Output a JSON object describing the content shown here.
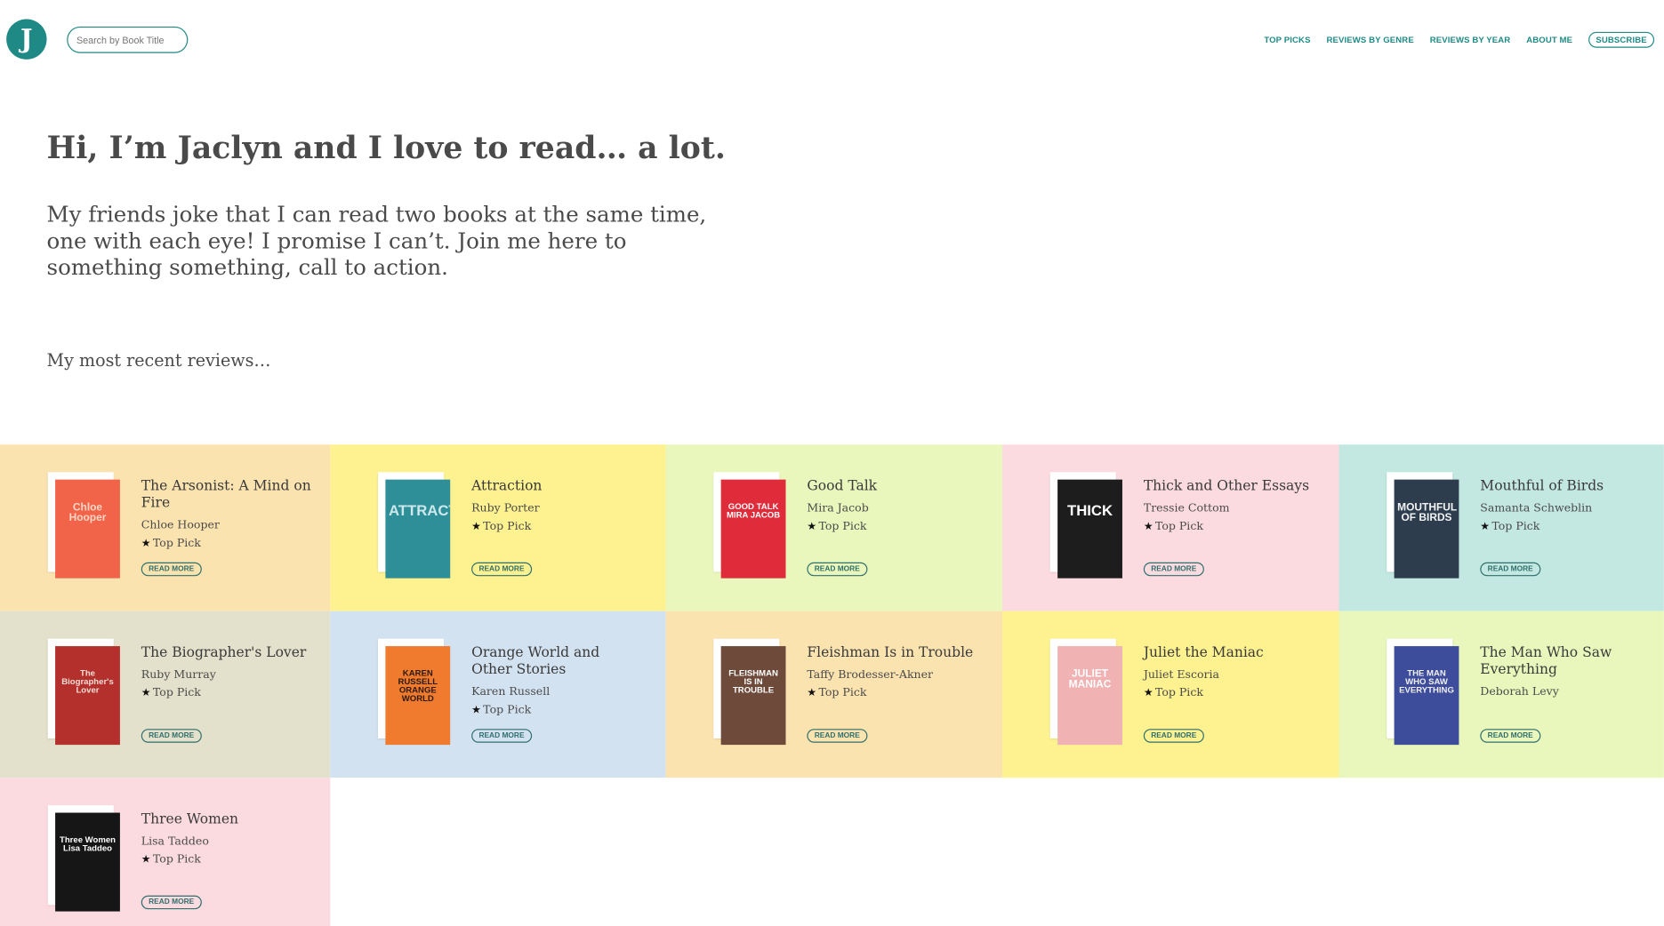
{
  "header": {
    "logo_letter": "J",
    "search_placeholder": "Search by Book Title",
    "nav": [
      {
        "label": "TOP PICKS"
      },
      {
        "label": "REVIEWS BY GENRE"
      },
      {
        "label": "REVIEWS BY YEAR"
      },
      {
        "label": "ABOUT ME"
      },
      {
        "label": "SUBSCRIBE"
      }
    ]
  },
  "hero": {
    "title": "Hi, I’m Jaclyn and I love to read… a lot.",
    "intro": "My friends joke that I can read two books at the same time, one with each eye! I promise I can’t. Join me here to something something, call to action.",
    "recent_label": "My most recent reviews…"
  },
  "read_more_label": "READ MORE",
  "top_pick_label": "Top Pick",
  "books": [
    {
      "title": "The Arsonist: A Mind on Fire",
      "author": "Chloe Hooper",
      "top_pick": true,
      "bg": "#fbe3b0",
      "cover_bg": "#f2644a",
      "cover_text": "Chloe Hooper",
      "cover_fg": "#fbd6c6"
    },
    {
      "title": "Attraction",
      "author": "Ruby Porter",
      "top_pick": true,
      "bg": "#fdf190",
      "cover_bg": "#2f8f98",
      "cover_text": "ATTRACTION",
      "cover_fg": "#cde8ec"
    },
    {
      "title": "Good Talk",
      "author": "Mira Jacob",
      "top_pick": true,
      "bg": "#eaf7bc",
      "cover_bg": "#e02c3a",
      "cover_text": "GOOD TALK MIRA JACOB",
      "cover_fg": "#ffffff"
    },
    {
      "title": "Thick and Other Essays",
      "author": "Tressie Cottom",
      "top_pick": true,
      "bg": "#fbdbe0",
      "cover_bg": "#1d1d1d",
      "cover_text": "THICK",
      "cover_fg": "#ffffff"
    },
    {
      "title": "Mouthful of Birds",
      "author": "Samanta Schweblin",
      "top_pick": true,
      "bg": "#c3e8e2",
      "cover_bg": "#2d3d4e",
      "cover_text": "MOUTHFUL OF BIRDS",
      "cover_fg": "#f3f3f3"
    },
    {
      "title": "The Biographer's Lover",
      "author": "Ruby Murray",
      "top_pick": true,
      "bg": "#e3e1cb",
      "cover_bg": "#b3302c",
      "cover_text": "The Biographer's Lover",
      "cover_fg": "#f6ddd6"
    },
    {
      "title": "Orange World and Other Stories",
      "author": "Karen Russell",
      "top_pick": true,
      "bg": "#d3e2f0",
      "cover_bg": "#f07a2e",
      "cover_text": "KAREN RUSSELL ORANGE WORLD",
      "cover_fg": "#2a1a10"
    },
    {
      "title": "Fleishman Is in Trouble",
      "author": "Taffy Brodesser-Akner",
      "top_pick": true,
      "bg": "#fbe3b0",
      "cover_bg": "#6e4a3a",
      "cover_text": "FLEISHMAN IS IN TROUBLE",
      "cover_fg": "#ffffff"
    },
    {
      "title": "Juliet the Maniac",
      "author": "Juliet Escoria",
      "top_pick": true,
      "bg": "#fdf190",
      "cover_bg": "#f0b2b2",
      "cover_text": "JULIET MANIAC",
      "cover_fg": "#ffffff"
    },
    {
      "title": "The Man Who Saw Everything",
      "author": "Deborah Levy",
      "top_pick": false,
      "bg": "#eaf7bc",
      "cover_bg": "#3d4d9c",
      "cover_text": "THE MAN WHO SAW EVERYTHING",
      "cover_fg": "#f0f0f0"
    },
    {
      "title": "Three Women",
      "author": "Lisa Taddeo",
      "top_pick": true,
      "bg": "#fbdbe0",
      "cover_bg": "#161616",
      "cover_text": "Three Women Lisa Taddeo",
      "cover_fg": "#ffffff"
    }
  ]
}
